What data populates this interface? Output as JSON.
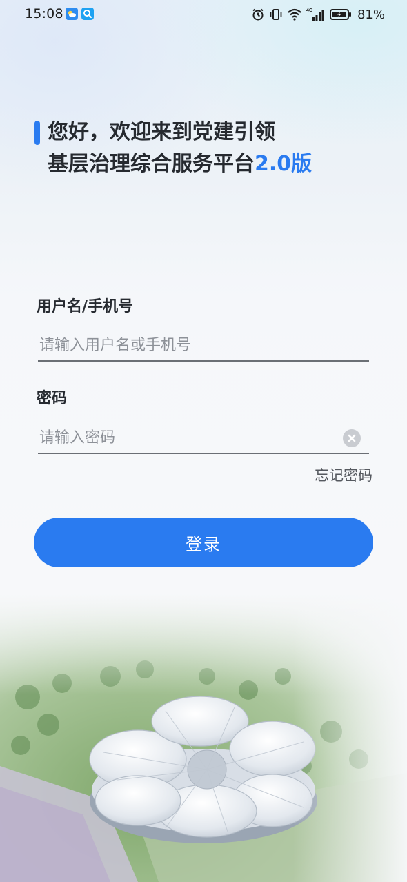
{
  "status_bar": {
    "time": "15:08",
    "battery_percent": "81%",
    "network_label": "4G",
    "icons": [
      "weather-app-icon",
      "search-app-icon",
      "alarm-icon",
      "vibrate-icon",
      "wifi-icon",
      "signal-icon",
      "battery-icon"
    ]
  },
  "greeting": {
    "line1": "您好，欢迎来到党建引领",
    "line2_prefix": "基层治理综合服务平台",
    "line2_highlight": "2.0版"
  },
  "form": {
    "username_label": "用户名/手机号",
    "username_placeholder": "请输入用户名或手机号",
    "username_value": "",
    "password_label": "密码",
    "password_placeholder": "请输入密码",
    "password_value": "",
    "forgot_password": "忘记密码",
    "login_button": "登录"
  },
  "colors": {
    "accent": "#2a7bf0",
    "text_primary": "#262a30",
    "placeholder": "#8d9198",
    "background": "#f7f8fa"
  }
}
